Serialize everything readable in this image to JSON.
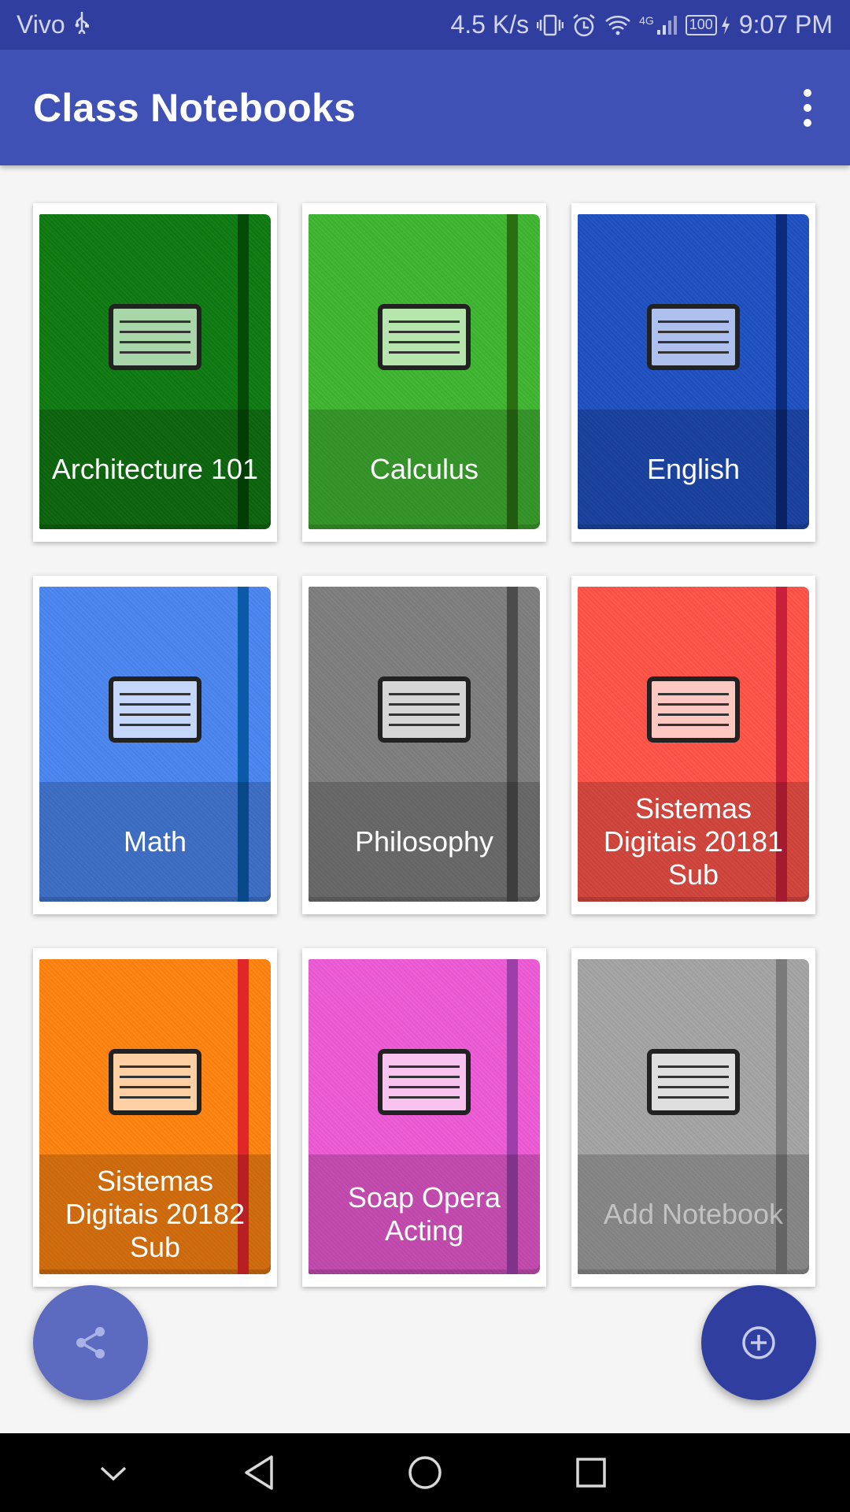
{
  "status_bar": {
    "carrier": "Vivo",
    "speed": "4.5 K/s",
    "network": "4G",
    "battery": "100",
    "time": "9:07 PM"
  },
  "app_bar": {
    "title": "Class Notebooks"
  },
  "notebooks": [
    {
      "label": "Architecture 101",
      "color": "#0e7a10",
      "strap": "#064a08",
      "plate": "#a9d6a9"
    },
    {
      "label": "Calculus",
      "color": "#3fb530",
      "strap": "#2a6e14",
      "plate": "#b6e6ae"
    },
    {
      "label": "English",
      "color": "#1e4fc2",
      "strap": "#0c2a7a",
      "plate": "#aec1ee"
    },
    {
      "label": "Math",
      "color": "#4a86ef",
      "strap": "#0b5aa8",
      "plate": "#c4d6fa"
    },
    {
      "label": "Philosophy",
      "color": "#7e7e7e",
      "strap": "#4c4c4c",
      "plate": "#d6d6d6"
    },
    {
      "label": "Sistemas Digitais 20181 Sub",
      "color": "#ff5348",
      "strap": "#c8203a",
      "plate": "#ffc7c2"
    },
    {
      "label": "Sistemas Digitais 20182 Sub",
      "color": "#ff830f",
      "strap": "#e1262a",
      "plate": "#ffd0a3"
    },
    {
      "label": "Soap Opera Acting",
      "color": "#ee5ad6",
      "strap": "#9c3fa8",
      "plate": "#f9c3ef"
    },
    {
      "label": "Add Notebook",
      "color": "#a4a4a4",
      "strap": "#7a7a7a",
      "plate": "#dedede",
      "muted": true
    }
  ],
  "fabs": {
    "share_icon": "share-icon",
    "add_icon": "add-circle-icon"
  },
  "nav_bar": {
    "buttons": [
      "collapse-icon",
      "back-icon",
      "home-icon",
      "recents-icon"
    ]
  }
}
